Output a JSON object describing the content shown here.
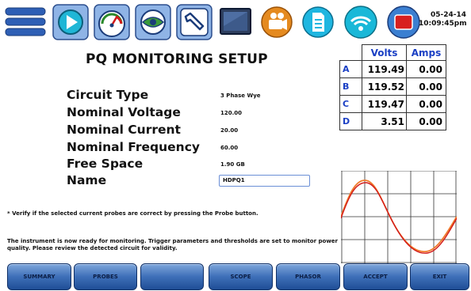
{
  "datetime": {
    "date": "05-24-14",
    "time": "10:09:45pm"
  },
  "toolbar_icons": [
    "menu-icon",
    "play-icon",
    "meter-gauge-icon",
    "eye-icon",
    "wrench-icon",
    "screen-icon",
    "video-camera-icon",
    "document-icon",
    "wireless-icon",
    "record-icon"
  ],
  "title": "PQ MONITORING SETUP",
  "readings": {
    "headers": [
      "Volts",
      "Amps"
    ],
    "rows": [
      {
        "phase": "A",
        "volts": "119.49",
        "amps": "0.00"
      },
      {
        "phase": "B",
        "volts": "119.52",
        "amps": "0.00"
      },
      {
        "phase": "C",
        "volts": "119.47",
        "amps": "0.00"
      },
      {
        "phase": "D",
        "volts": "3.51",
        "amps": "0.00"
      }
    ]
  },
  "settings": [
    {
      "label": "Circuit Type",
      "value": "3 Phase Wye"
    },
    {
      "label": "Nominal Voltage",
      "value": "120.00"
    },
    {
      "label": "Nominal Current",
      "value": "20.00"
    },
    {
      "label": "Nominal Frequency",
      "value": "60.00"
    },
    {
      "label": "Free Space",
      "value": "1.90 GB"
    }
  ],
  "name_field": {
    "label": "Name",
    "value": "HDPQ1"
  },
  "notes": {
    "probe_note": "* Verify if the selected current probes are correct by pressing the Probe button.",
    "ready_note": "The instrument is now ready for monitoring. Trigger parameters and thresholds are set to monitor power quality. Please review the detected circuit for validity."
  },
  "buttons": {
    "summary": "SUMMARY",
    "probes": "PROBES",
    "blank": "",
    "scope": "SCOPE",
    "phasor": "PHASOR",
    "accept": "ACCEPT",
    "exit": "EXIT"
  },
  "colors": {
    "accent_blue": "#1a3fc4",
    "button_blue": "#3e6fb8",
    "wave_orange": "#f07a2a",
    "wave_red": "#d21a1a"
  }
}
